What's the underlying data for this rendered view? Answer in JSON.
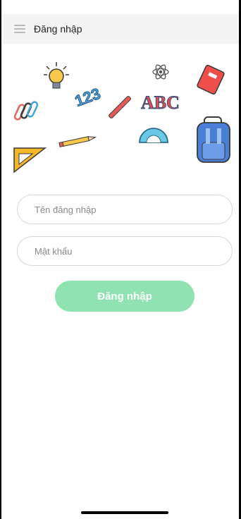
{
  "header": {
    "title": "Đăng nhập",
    "menu_icon": "menu-icon"
  },
  "illustration": {
    "number_text": "123",
    "abc_text": "ABC",
    "icons": [
      "lightbulb-icon",
      "numbers-icon",
      "atom-icon",
      "book-icon",
      "abc-icon",
      "ruler-icon",
      "paperclips-icon",
      "pencil-icon",
      "protractor-icon",
      "backpack-icon",
      "set-square-icon"
    ]
  },
  "form": {
    "username_placeholder": "Tên đăng nhập",
    "password_placeholder": "Mật khẩu",
    "submit_label": "Đăng nhập"
  },
  "colors": {
    "accent": "#8fe3b0",
    "header_bg": "#f4f4f4"
  }
}
